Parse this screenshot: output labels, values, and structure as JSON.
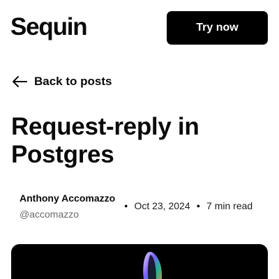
{
  "header": {
    "logo_text": "Sequin",
    "cta_label": "Try now"
  },
  "nav": {
    "back_label": "Back to posts",
    "back_icon": "arrow-left-icon"
  },
  "post": {
    "title": "Request-reply in Postgres",
    "author_name": "Anthony Accomazzo",
    "author_handle": "@accomazzo",
    "date": "Oct 23, 2024",
    "read_time": "7 min read"
  },
  "colors": {
    "accent": "#000000",
    "text": "#0a0a0a",
    "muted": "#6b6b6b"
  }
}
